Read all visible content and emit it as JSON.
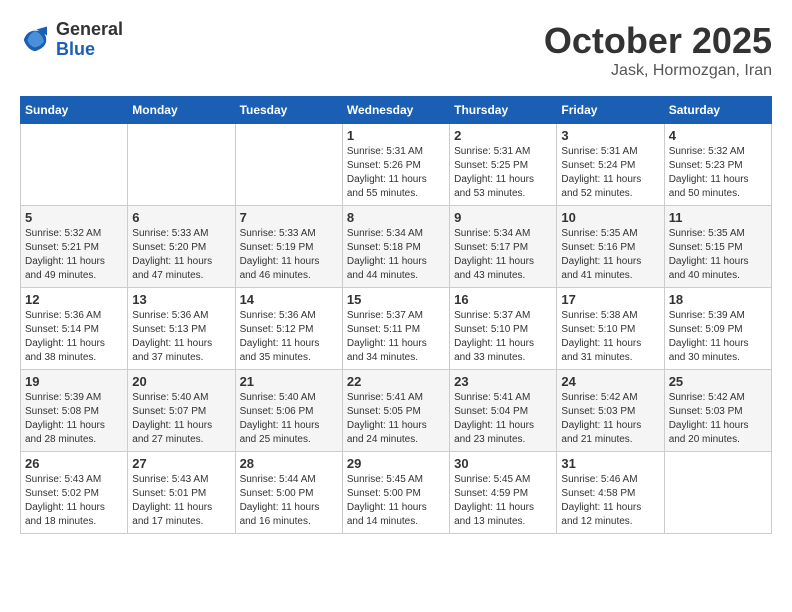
{
  "header": {
    "logo_general": "General",
    "logo_blue": "Blue",
    "title": "October 2025",
    "location": "Jask, Hormozgan, Iran"
  },
  "days_of_week": [
    "Sunday",
    "Monday",
    "Tuesday",
    "Wednesday",
    "Thursday",
    "Friday",
    "Saturday"
  ],
  "weeks": [
    [
      {
        "day": "",
        "info": ""
      },
      {
        "day": "",
        "info": ""
      },
      {
        "day": "",
        "info": ""
      },
      {
        "day": "1",
        "info": "Sunrise: 5:31 AM\nSunset: 5:26 PM\nDaylight: 11 hours\nand 55 minutes."
      },
      {
        "day": "2",
        "info": "Sunrise: 5:31 AM\nSunset: 5:25 PM\nDaylight: 11 hours\nand 53 minutes."
      },
      {
        "day": "3",
        "info": "Sunrise: 5:31 AM\nSunset: 5:24 PM\nDaylight: 11 hours\nand 52 minutes."
      },
      {
        "day": "4",
        "info": "Sunrise: 5:32 AM\nSunset: 5:23 PM\nDaylight: 11 hours\nand 50 minutes."
      }
    ],
    [
      {
        "day": "5",
        "info": "Sunrise: 5:32 AM\nSunset: 5:21 PM\nDaylight: 11 hours\nand 49 minutes."
      },
      {
        "day": "6",
        "info": "Sunrise: 5:33 AM\nSunset: 5:20 PM\nDaylight: 11 hours\nand 47 minutes."
      },
      {
        "day": "7",
        "info": "Sunrise: 5:33 AM\nSunset: 5:19 PM\nDaylight: 11 hours\nand 46 minutes."
      },
      {
        "day": "8",
        "info": "Sunrise: 5:34 AM\nSunset: 5:18 PM\nDaylight: 11 hours\nand 44 minutes."
      },
      {
        "day": "9",
        "info": "Sunrise: 5:34 AM\nSunset: 5:17 PM\nDaylight: 11 hours\nand 43 minutes."
      },
      {
        "day": "10",
        "info": "Sunrise: 5:35 AM\nSunset: 5:16 PM\nDaylight: 11 hours\nand 41 minutes."
      },
      {
        "day": "11",
        "info": "Sunrise: 5:35 AM\nSunset: 5:15 PM\nDaylight: 11 hours\nand 40 minutes."
      }
    ],
    [
      {
        "day": "12",
        "info": "Sunrise: 5:36 AM\nSunset: 5:14 PM\nDaylight: 11 hours\nand 38 minutes."
      },
      {
        "day": "13",
        "info": "Sunrise: 5:36 AM\nSunset: 5:13 PM\nDaylight: 11 hours\nand 37 minutes."
      },
      {
        "day": "14",
        "info": "Sunrise: 5:36 AM\nSunset: 5:12 PM\nDaylight: 11 hours\nand 35 minutes."
      },
      {
        "day": "15",
        "info": "Sunrise: 5:37 AM\nSunset: 5:11 PM\nDaylight: 11 hours\nand 34 minutes."
      },
      {
        "day": "16",
        "info": "Sunrise: 5:37 AM\nSunset: 5:10 PM\nDaylight: 11 hours\nand 33 minutes."
      },
      {
        "day": "17",
        "info": "Sunrise: 5:38 AM\nSunset: 5:10 PM\nDaylight: 11 hours\nand 31 minutes."
      },
      {
        "day": "18",
        "info": "Sunrise: 5:39 AM\nSunset: 5:09 PM\nDaylight: 11 hours\nand 30 minutes."
      }
    ],
    [
      {
        "day": "19",
        "info": "Sunrise: 5:39 AM\nSunset: 5:08 PM\nDaylight: 11 hours\nand 28 minutes."
      },
      {
        "day": "20",
        "info": "Sunrise: 5:40 AM\nSunset: 5:07 PM\nDaylight: 11 hours\nand 27 minutes."
      },
      {
        "day": "21",
        "info": "Sunrise: 5:40 AM\nSunset: 5:06 PM\nDaylight: 11 hours\nand 25 minutes."
      },
      {
        "day": "22",
        "info": "Sunrise: 5:41 AM\nSunset: 5:05 PM\nDaylight: 11 hours\nand 24 minutes."
      },
      {
        "day": "23",
        "info": "Sunrise: 5:41 AM\nSunset: 5:04 PM\nDaylight: 11 hours\nand 23 minutes."
      },
      {
        "day": "24",
        "info": "Sunrise: 5:42 AM\nSunset: 5:03 PM\nDaylight: 11 hours\nand 21 minutes."
      },
      {
        "day": "25",
        "info": "Sunrise: 5:42 AM\nSunset: 5:03 PM\nDaylight: 11 hours\nand 20 minutes."
      }
    ],
    [
      {
        "day": "26",
        "info": "Sunrise: 5:43 AM\nSunset: 5:02 PM\nDaylight: 11 hours\nand 18 minutes."
      },
      {
        "day": "27",
        "info": "Sunrise: 5:43 AM\nSunset: 5:01 PM\nDaylight: 11 hours\nand 17 minutes."
      },
      {
        "day": "28",
        "info": "Sunrise: 5:44 AM\nSunset: 5:00 PM\nDaylight: 11 hours\nand 16 minutes."
      },
      {
        "day": "29",
        "info": "Sunrise: 5:45 AM\nSunset: 5:00 PM\nDaylight: 11 hours\nand 14 minutes."
      },
      {
        "day": "30",
        "info": "Sunrise: 5:45 AM\nSunset: 4:59 PM\nDaylight: 11 hours\nand 13 minutes."
      },
      {
        "day": "31",
        "info": "Sunrise: 5:46 AM\nSunset: 4:58 PM\nDaylight: 11 hours\nand 12 minutes."
      },
      {
        "day": "",
        "info": ""
      }
    ]
  ]
}
